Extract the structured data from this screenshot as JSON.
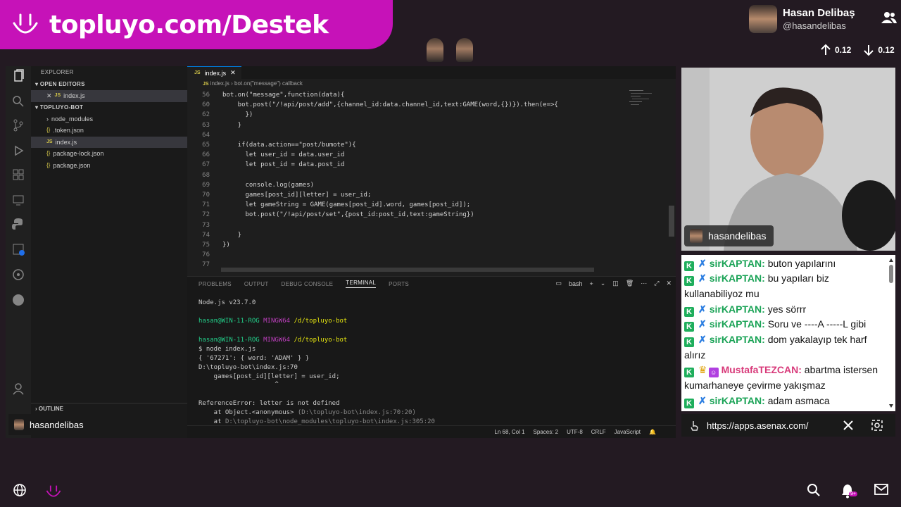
{
  "banner": {
    "title": "topluyo.com/Destek"
  },
  "user": {
    "name": "Hasan Delibaş",
    "handle": "@hasandelibas"
  },
  "votes": {
    "up": "0.12",
    "down": "0.12"
  },
  "explorer": {
    "header": "EXPLORER",
    "open_editors": "OPEN EDITORS",
    "open_file": "index.js",
    "project": "TOPLUYO-BOT",
    "items": [
      "node_modules",
      ".token.json",
      "index.js",
      "package-lock.json",
      "package.json"
    ],
    "outline": "OUTLINE"
  },
  "editor": {
    "tab": "index.js",
    "breadcrumb_file": "index.js",
    "breadcrumb_symbol": "bot.on(\"message\") callback",
    "lines": [
      {
        "n": "56",
        "t": "bot.on(\"message\",function(data){"
      },
      {
        "n": "60",
        "t": "    bot.post(\"/!api/post/add\",{channel_id:data.channel_id,text:GAME(word,{})}).then(e=>{"
      },
      {
        "n": "62",
        "t": "      })"
      },
      {
        "n": "63",
        "t": "    }"
      },
      {
        "n": "64",
        "t": ""
      },
      {
        "n": "65",
        "t": "    if(data.action==\"post/bumote\"){"
      },
      {
        "n": "66",
        "t": "      let user_id = data.user_id"
      },
      {
        "n": "67",
        "t": "      let post_id = data.post_id"
      },
      {
        "n": "68",
        "t": ""
      },
      {
        "n": "69",
        "t": "      console.log(games)"
      },
      {
        "n": "70",
        "t": "      games[post_id][letter] = user_id;"
      },
      {
        "n": "71",
        "t": "      let gameString = GAME(games[post_id].word, games[post_id]);"
      },
      {
        "n": "72",
        "t": "      bot.post(\"/!api/post/set\",{post_id:post_id,text:gameString})"
      },
      {
        "n": "73",
        "t": ""
      },
      {
        "n": "74",
        "t": "    }"
      },
      {
        "n": "75",
        "t": "})"
      },
      {
        "n": "76",
        "t": ""
      },
      {
        "n": "77",
        "t": ""
      }
    ]
  },
  "panel": {
    "tabs": [
      "PROBLEMS",
      "OUTPUT",
      "DEBUG CONSOLE",
      "TERMINAL",
      "PORTS"
    ],
    "active_tab": "TERMINAL",
    "shell": "bash",
    "terminal": {
      "node_version": "Node.js v23.7.0",
      "prompt_user": "hasan@WIN-11-ROG",
      "prompt_env": "MINGW64",
      "prompt_path": "/d/topluyo-bot",
      "command": "$ node index.js",
      "obj_line": "{ '67271': { word: 'ADAM' } }",
      "err_path": "D:\\topluyo-bot\\index.js:70",
      "err_code": "    games[post_id][letter] = user_id;",
      "err_caret": "                    ^",
      "err_msg": "ReferenceError: letter is not defined",
      "stack1_a": "    at Object.<anonymous> ",
      "stack1_b": "(D:\\topluyo-bot\\index.js:70:20)",
      "stack2_a": "    at ",
      "stack2_b": "D:\\topluyo-bot\\node_modules\\topluyo-bot\\index.js:305:20"
    }
  },
  "statusbar": {
    "position": "Ln 68, Col 1",
    "spaces": "Spaces: 2",
    "encoding": "UTF-8",
    "eol": "CRLF",
    "language": "JavaScript"
  },
  "presenter_chip": "hasandelibas",
  "cam_tag": "hasandelibas",
  "chat": [
    {
      "user": "sirKAPTAN",
      "text": "buton yapılarını",
      "type": "green"
    },
    {
      "user": "sirKAPTAN",
      "text": "bu yapıları biz kullanabiliyoz mu",
      "type": "green"
    },
    {
      "user": "sirKAPTAN",
      "text": "yes sörrr",
      "type": "green"
    },
    {
      "user": "sirKAPTAN",
      "text": "Soru ve ----A -----L gibi",
      "type": "green"
    },
    {
      "user": "sirKAPTAN",
      "text": "dom yakalayıp tek harf alırız",
      "type": "green"
    },
    {
      "user": "MustafaTEZCAN",
      "text": "abartma istersen kumarhaneye çevirme yakışmaz",
      "type": "red"
    },
    {
      "user": "sirKAPTAN",
      "text": "adam asmaca",
      "type": "green"
    }
  ],
  "url": "https://apps.asenax.com/",
  "notifications_badge": "9+",
  "colors": {
    "brand": "#c612b8",
    "bg": "#231a22",
    "chat_green": "#1aa356",
    "chat_red": "#d83a7a"
  }
}
